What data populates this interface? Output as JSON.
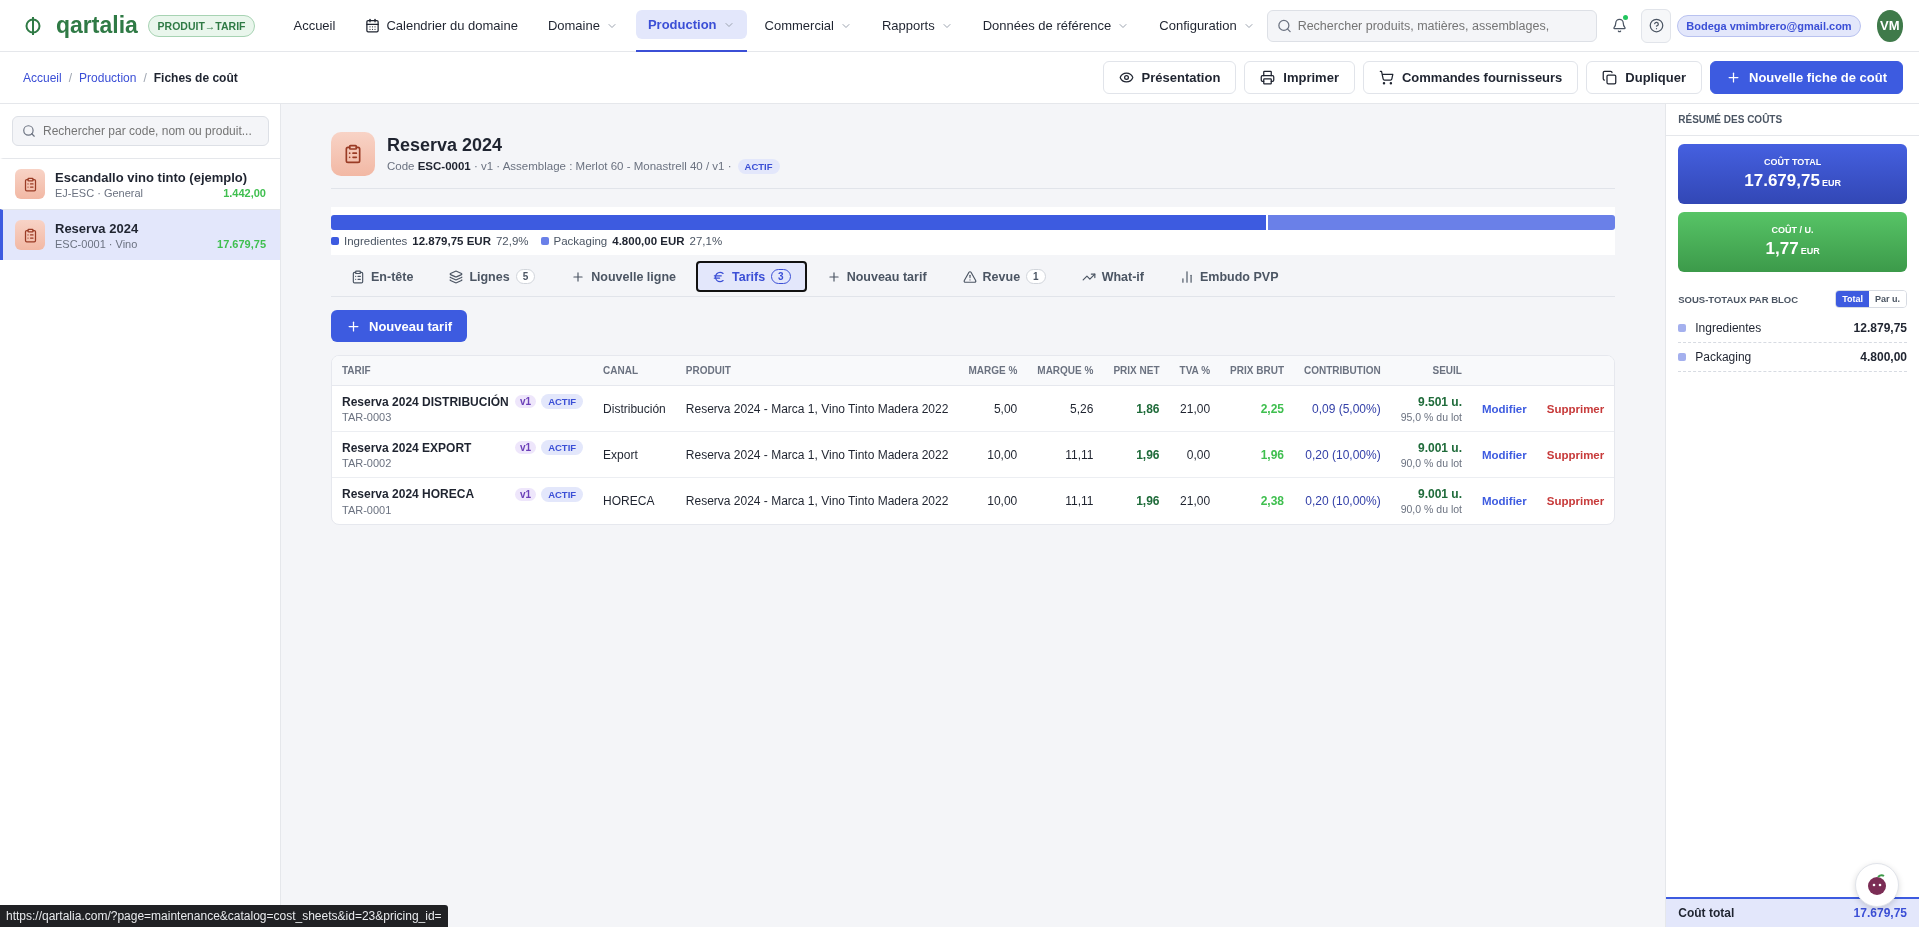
{
  "app": {
    "logo": "qartalia",
    "mode_badge": "PRODUIT→TARIF"
  },
  "nav": [
    {
      "label": "Accueil",
      "kind": "link",
      "selected": false
    },
    {
      "label": "Calendrier du domaine",
      "kind": "calendar",
      "selected": false
    },
    {
      "label": "Domaine",
      "kind": "menu",
      "selected": false
    },
    {
      "label": "Production",
      "kind": "menu",
      "selected": true
    },
    {
      "label": "Commercial",
      "kind": "menu",
      "selected": false
    },
    {
      "label": "Rapports",
      "kind": "menu",
      "selected": false
    },
    {
      "label": "Données de référence",
      "kind": "menu",
      "selected": false
    },
    {
      "label": "Configuration",
      "kind": "menu",
      "selected": false
    }
  ],
  "search": {
    "placeholder": "Rechercher produits, matières, assemblages,"
  },
  "notifications": {
    "unread": true
  },
  "user": {
    "label": "Bodega vmimbrero@gmail.com",
    "initials": "VM"
  },
  "breadcrumb": [
    {
      "label": "Accueil",
      "current": false
    },
    {
      "separator": "/",
      "label": "Production",
      "current": false
    },
    {
      "separator": "/",
      "label": "Fiches de coût",
      "current": true
    }
  ],
  "actions": [
    {
      "label": "Présentation",
      "primary": false
    },
    {
      "label": "Imprimer",
      "primary": false
    },
    {
      "label": "Commandes fournisseurs",
      "primary": false
    },
    {
      "label": "Dupliquer",
      "primary": false
    },
    {
      "label": "Nouvelle fiche de coût",
      "primary": true
    }
  ],
  "sidebar": {
    "search_placeholder": "Rechercher par code, nom ou produit...",
    "items": [
      {
        "title": "Escandallo vino tinto (ejemplo)",
        "subtitle": "EJ-ESC · General",
        "amount": "1.442,00",
        "selected": false
      },
      {
        "title": "Reserva 2024",
        "subtitle": "ESC-0001 · Vino",
        "amount": "17.679,75",
        "selected": true
      }
    ]
  },
  "sheet": {
    "title": "Reserva 2024",
    "meta": "Code  **ESC-0001** · v1 · Assemblage : Merlot 60 - Monastrell 40 / v1 ·",
    "status": "ACTIF"
  },
  "breakdown": [
    {
      "name": "Ingredientes",
      "amount": "12.879,75 EUR",
      "percent": "72,9%",
      "level": 0.729,
      "color": "#3d5be0"
    },
    {
      "name": "Packaging",
      "amount": "4.800,00 EUR",
      "percent": "27,1%",
      "level": 0.271,
      "color": "#6a80e8"
    }
  ],
  "tabs": [
    {
      "label": "En-tête",
      "selected": false
    },
    {
      "label": "Lignes",
      "count": "5",
      "selected": false
    },
    {
      "label": "Nouvelle ligne",
      "selected": false
    },
    {
      "label": "Tarifs",
      "count": "3",
      "selected": true
    },
    {
      "label": "Nouveau tarif",
      "selected": false
    },
    {
      "label": "Revue",
      "count": "1",
      "selected": false
    },
    {
      "label": "What-if",
      "selected": false
    },
    {
      "label": "Embudo PVP",
      "selected": false
    }
  ],
  "new_button": "Nouveau tarif",
  "table": {
    "columns": [
      "TARIF",
      "CANAL",
      "PRODUIT",
      "MARGE %",
      "MARQUE %",
      "PRIX NET",
      "TVA %",
      "PRIX BRUT",
      "CONTRIBUTION",
      "SEUIL"
    ],
    "rows": [
      {
        "name": "Reserva 2024 DISTRIBUCIÓN",
        "version": "v1",
        "status": "ACTIF",
        "code": "TAR-0003",
        "canal": "Distribución",
        "produit": "Reserva 2024 - Marca 1, Vino Tinto Madera 2022",
        "marge": "5,00",
        "marque": "5,26",
        "prix_net": "1,86",
        "tva": "21,00",
        "prix_brut": "2,25",
        "contribution": "0,09 (5,00%)",
        "seuil": "9.501 u.",
        "seuil_note": "95,0 % du lot",
        "edit": "Modifier",
        "delete": "Supprimer"
      },
      {
        "name": "Reserva 2024 EXPORT",
        "version": "v1",
        "status": "ACTIF",
        "code": "TAR-0002",
        "canal": "Export",
        "produit": "Reserva 2024 - Marca 1, Vino Tinto Madera 2022",
        "marge": "10,00",
        "marque": "11,11",
        "prix_net": "1,96",
        "tva": "0,00",
        "prix_brut": "1,96",
        "contribution": "0,20 (10,00%)",
        "seuil": "9.001 u.",
        "seuil_note": "90,0 % du lot",
        "edit": "Modifier",
        "delete": "Supprimer"
      },
      {
        "name": "Reserva 2024 HORECA",
        "version": "v1",
        "status": "ACTIF",
        "code": "TAR-0001",
        "canal": "HORECA",
        "produit": "Reserva 2024 - Marca 1, Vino Tinto Madera 2022",
        "marge": "10,00",
        "marque": "11,11",
        "prix_net": "1,96",
        "tva": "21,00",
        "prix_brut": "2,38",
        "contribution": "0,20 (10,00%)",
        "seuil": "9.001 u.",
        "seuil_note": "90,0 % du lot",
        "edit": "Modifier",
        "delete": "Supprimer"
      }
    ]
  },
  "summary": {
    "title": "RÉSUMÉ DES COÛTS",
    "cards": [
      {
        "label": "COÛT TOTAL",
        "value": "17.679,75",
        "unit": "EUR",
        "kind": "total"
      },
      {
        "label": "COÛT / U.",
        "value": "1,77",
        "unit": "EUR",
        "kind": "unit"
      }
    ],
    "subtotals_title": "SOUS-TOTAUX PAR BLOC",
    "toggle": [
      {
        "label": "Total",
        "selected": true
      },
      {
        "label": "Par u.",
        "selected": false
      }
    ],
    "subtotals": [
      {
        "name": "Ingredientes",
        "value": "12.879,75"
      },
      {
        "name": "Packaging",
        "value": "4.800,00"
      }
    ],
    "footer": {
      "label": "Coût total",
      "value": "17.679,75"
    }
  },
  "status_url": "https://qartalia.com/?page=maintenance&catalog=cost_sheets&id=23&pricing_id="
}
